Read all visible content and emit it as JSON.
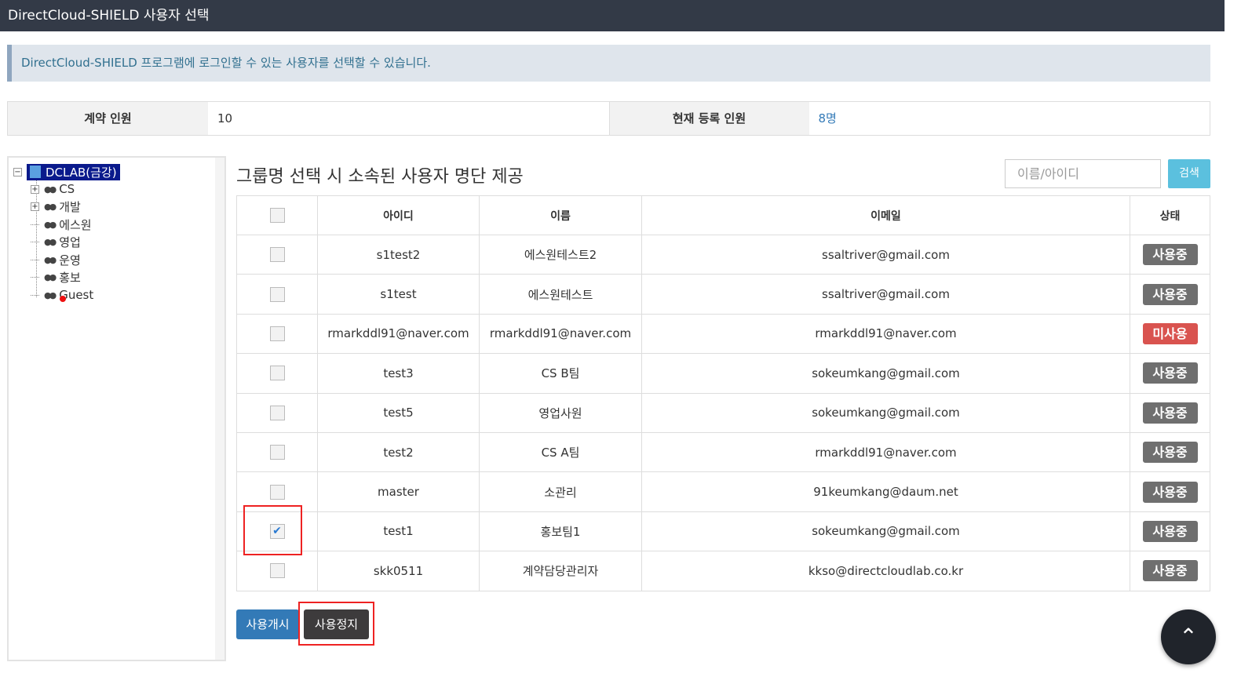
{
  "title": "DirectCloud-SHIELD 사용자 선택",
  "info": "DirectCloud-SHIELD 프로그램에 로그인할 수 있는 사용자를 선택할 수 있습니다.",
  "stats": {
    "contract_label": "계약 인원",
    "contract_value": "10",
    "registered_label": "현재 등록 인원",
    "registered_value": "8명"
  },
  "tree": {
    "root": "DCLAB(금강)",
    "groups": [
      "CS",
      "개발",
      "에스원",
      "영업",
      "운영",
      "홍보",
      "Guest"
    ]
  },
  "heading": "그룹명 선택 시 소속된 사용자 명단 제공",
  "search": {
    "placeholder": "이름/아이디",
    "button": "검색"
  },
  "table": {
    "headers": [
      "아이디",
      "이름",
      "이메일",
      "상태"
    ],
    "rows": [
      {
        "id": "s1test2",
        "name": "에스원테스트2",
        "email": "ssaltriver@gmail.com",
        "status": "사용중",
        "checked": false
      },
      {
        "id": "s1test",
        "name": "에스원테스트",
        "email": "ssaltriver@gmail.com",
        "status": "사용중",
        "checked": false
      },
      {
        "id": "rmarkddl91@naver.com",
        "name": "rmarkddl91@naver.com",
        "email": "rmarkddl91@naver.com",
        "status": "미사용",
        "checked": false
      },
      {
        "id": "test3",
        "name": "CS B팀",
        "email": "sokeumkang@gmail.com",
        "status": "사용중",
        "checked": false
      },
      {
        "id": "test5",
        "name": "영업사원",
        "email": "sokeumkang@gmail.com",
        "status": "사용중",
        "checked": false
      },
      {
        "id": "test2",
        "name": "CS A팀",
        "email": "rmarkddl91@naver.com",
        "status": "사용중",
        "checked": false
      },
      {
        "id": "master",
        "name": "소관리",
        "email": "91keumkang@daum.net",
        "status": "사용중",
        "checked": false
      },
      {
        "id": "test1",
        "name": "홍보팀1",
        "email": "sokeumkang@gmail.com",
        "status": "사용중",
        "checked": true
      },
      {
        "id": "skk0511",
        "name": "계약담당관리자",
        "email": "kkso@directcloudlab.co.kr",
        "status": "사용중",
        "checked": false
      }
    ]
  },
  "buttons": {
    "start": "사용개시",
    "stop": "사용정지"
  },
  "colors": {
    "start": "#337ab7",
    "stop": "#3d3b3c",
    "active": "#6f6f6f",
    "inactive": "#d9534f"
  }
}
